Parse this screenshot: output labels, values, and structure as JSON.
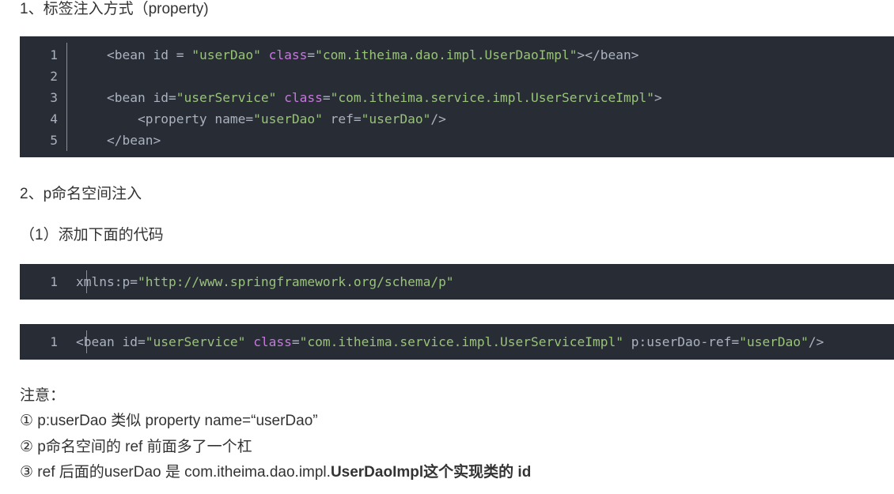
{
  "section1": {
    "heading": "1、标签注入方式（property)",
    "code": {
      "lines": [
        {
          "num": "1",
          "indent": "    ",
          "tokens": [
            {
              "t": "tag",
              "v": "<bean"
            },
            {
              "t": "plain",
              "v": " id "
            },
            {
              "t": "punc",
              "v": "="
            },
            {
              "t": "plain",
              "v": " "
            },
            {
              "t": "str",
              "v": "\"userDao\""
            },
            {
              "t": "plain",
              "v": " "
            },
            {
              "t": "kw",
              "v": "class"
            },
            {
              "t": "punc",
              "v": "="
            },
            {
              "t": "str",
              "v": "\"com.itheima.dao.impl.UserDaoImpl\""
            },
            {
              "t": "tag",
              "v": "></bean>"
            }
          ]
        },
        {
          "num": "2",
          "indent": "",
          "tokens": []
        },
        {
          "num": "3",
          "indent": "    ",
          "tokens": [
            {
              "t": "tag",
              "v": "<bean"
            },
            {
              "t": "plain",
              "v": " id"
            },
            {
              "t": "punc",
              "v": "="
            },
            {
              "t": "str",
              "v": "\"userService\""
            },
            {
              "t": "plain",
              "v": " "
            },
            {
              "t": "kw",
              "v": "class"
            },
            {
              "t": "punc",
              "v": "="
            },
            {
              "t": "str",
              "v": "\"com.itheima.service.impl.UserServiceImpl\""
            },
            {
              "t": "tag",
              "v": ">"
            }
          ]
        },
        {
          "num": "4",
          "indent": "        ",
          "tokens": [
            {
              "t": "tag",
              "v": "<property"
            },
            {
              "t": "plain",
              "v": " name"
            },
            {
              "t": "punc",
              "v": "="
            },
            {
              "t": "str",
              "v": "\"userDao\""
            },
            {
              "t": "plain",
              "v": " ref"
            },
            {
              "t": "punc",
              "v": "="
            },
            {
              "t": "str",
              "v": "\"userDao\""
            },
            {
              "t": "tag",
              "v": "/>"
            }
          ]
        },
        {
          "num": "5",
          "indent": "    ",
          "tokens": [
            {
              "t": "tag",
              "v": "</bean>"
            }
          ]
        }
      ]
    }
  },
  "section2": {
    "heading": "2、p命名空间注入",
    "subheading": "（1）添加下面的代码",
    "code_a": {
      "lines": [
        {
          "num": "1",
          "indent": "",
          "tokens": [
            {
              "t": "plain",
              "v": "xmlns:p"
            },
            {
              "t": "punc",
              "v": "="
            },
            {
              "t": "str",
              "v": "\"http://www.springframework.org/schema/p\""
            }
          ]
        }
      ]
    },
    "code_b": {
      "lines": [
        {
          "num": "1",
          "indent": "",
          "tokens": [
            {
              "t": "tag",
              "v": "<bean"
            },
            {
              "t": "plain",
              "v": " id"
            },
            {
              "t": "punc",
              "v": "="
            },
            {
              "t": "str",
              "v": "\"userService\""
            },
            {
              "t": "plain",
              "v": " "
            },
            {
              "t": "kw",
              "v": "class"
            },
            {
              "t": "punc",
              "v": "="
            },
            {
              "t": "str",
              "v": "\"com.itheima.service.impl.UserServiceImpl\""
            },
            {
              "t": "plain",
              "v": " p:userDao-ref"
            },
            {
              "t": "punc",
              "v": "="
            },
            {
              "t": "str",
              "v": "\"userDao\""
            },
            {
              "t": "tag",
              "v": "/>"
            }
          ]
        }
      ]
    }
  },
  "notes": {
    "title": "注意：",
    "items": [
      {
        "text": "① p:userDao 类似 property name=“userDao”"
      },
      {
        "text": "② p命名空间的 ref 前面多了一个杠"
      },
      {
        "text_normal": "③ ref 后面的userDao 是 com.itheima.dao.impl.",
        "text_bold": "UserDaoImpl这个实现类的 id"
      }
    ]
  },
  "colors": {
    "code_bg": "#282c34",
    "code_plain": "#abb2bf",
    "code_keyword": "#c678dd",
    "code_string": "#98c379",
    "text": "#333333"
  }
}
